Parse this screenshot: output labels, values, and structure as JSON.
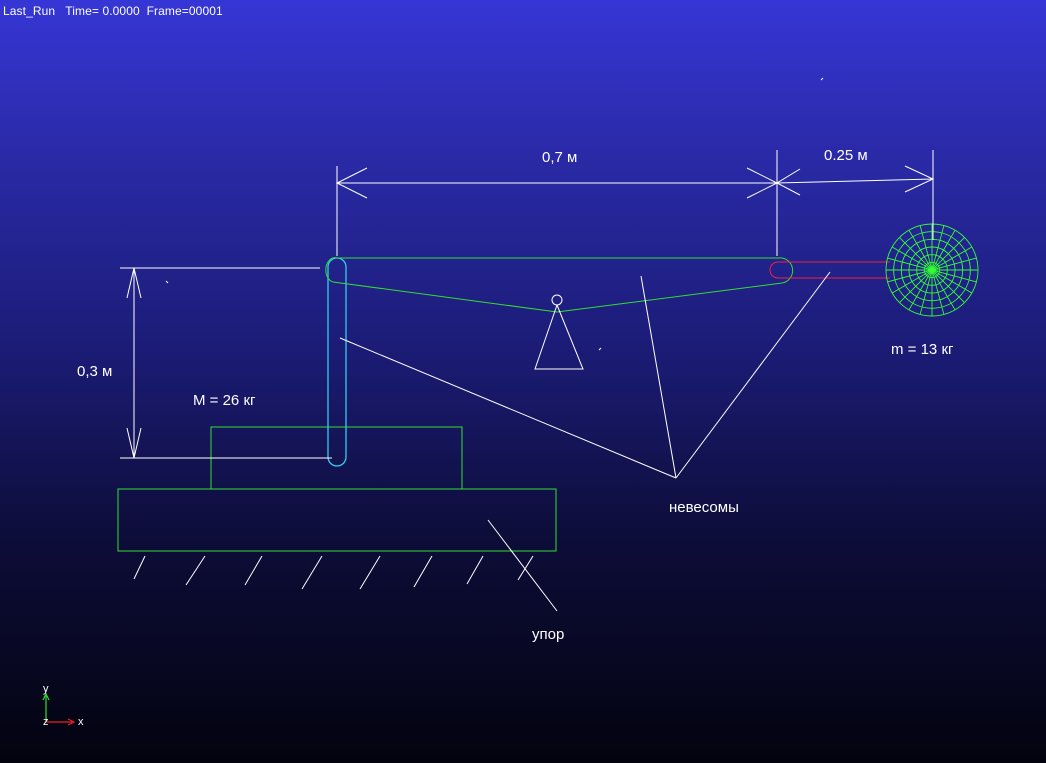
{
  "status": {
    "run_name": "Last_Run",
    "time_label": "Time=",
    "time_value": "0.0000",
    "frame_label": "Frame=",
    "frame_value": "00001"
  },
  "labels": {
    "dim_lever_left": "0,7 м",
    "dim_lever_right": "0.25 м",
    "dim_height": "0,3 м",
    "mass_big": "M = 26 кг",
    "mass_small": "m = 13 кг",
    "weightless": "невесомы",
    "stop": "упор"
  },
  "triad": {
    "y": "y",
    "z": "z",
    "x": "x"
  },
  "colors": {
    "bg_top": "#3636d6",
    "bg_bottom": "#03030f",
    "body_outline": "#33dd33",
    "slider_link": "#33ccee",
    "red_link": "#ee2244",
    "sphere": "#33ff33",
    "annotation": "#ffffff"
  }
}
